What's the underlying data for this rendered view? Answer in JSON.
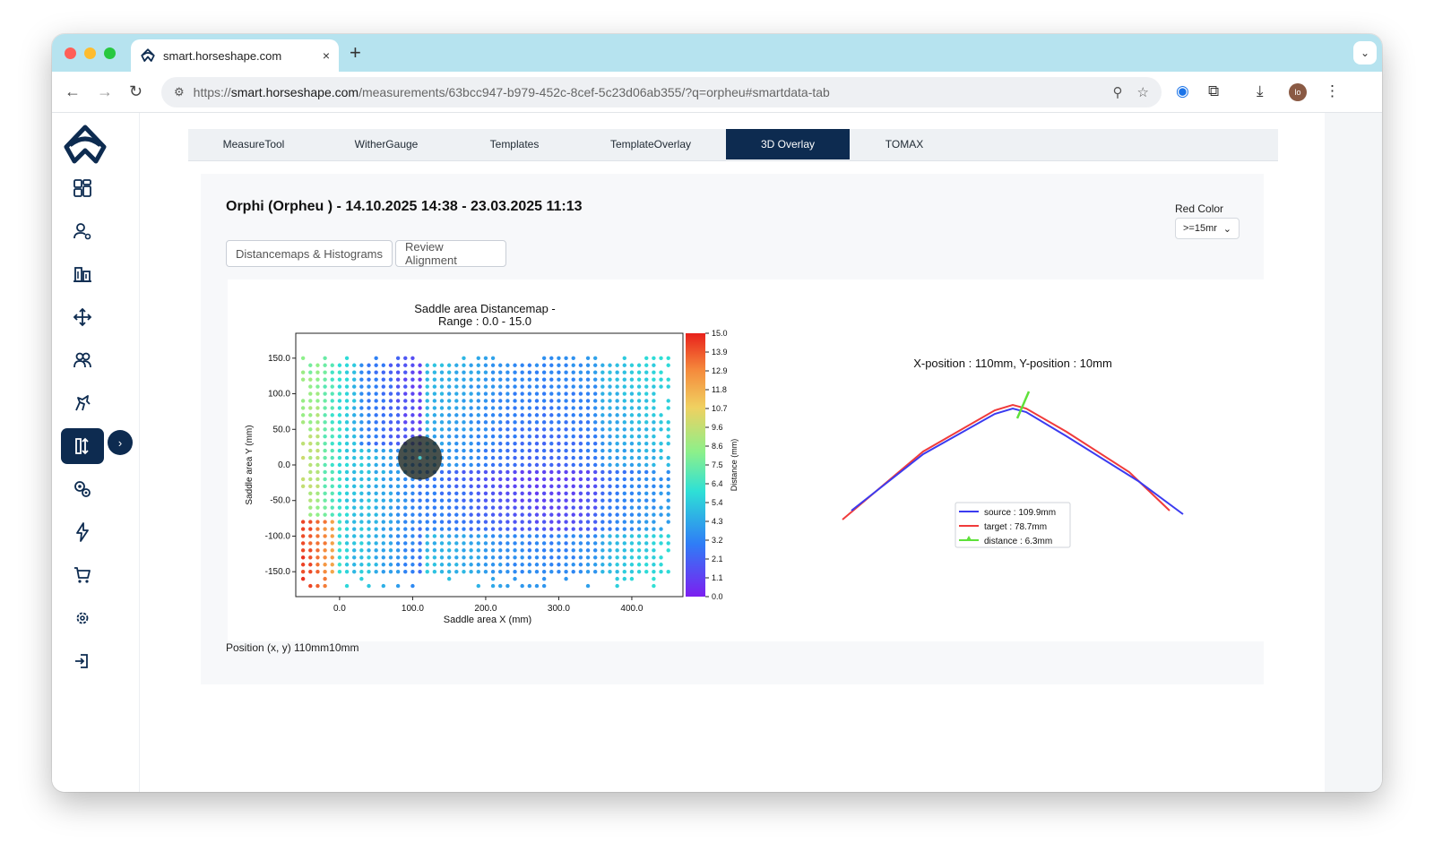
{
  "browser": {
    "tab_title": "smart.horseshape.com",
    "new_tab": "+",
    "close": "×",
    "url_prefix": "https://",
    "url_host": "smart.horseshape.com",
    "url_path": "/measurements/63bcc947-b979-452c-8cef-5c23d06ab355/?q=orpheu#smartdata-tab",
    "profile_initials": "lo"
  },
  "sidebar": {
    "items": [
      {
        "icon": "dashboard-icon"
      },
      {
        "icon": "user-icon"
      },
      {
        "icon": "building-icon"
      },
      {
        "icon": "move-arrows-icon"
      },
      {
        "icon": "team-icon"
      },
      {
        "icon": "horse-icon"
      },
      {
        "icon": "measure-compare-icon",
        "active": true
      },
      {
        "icon": "gears-icon"
      },
      {
        "icon": "lightning-icon"
      },
      {
        "icon": "cart-icon"
      },
      {
        "icon": "settings-icon"
      },
      {
        "icon": "logout-icon"
      }
    ],
    "expand": "›"
  },
  "tabs": [
    {
      "label": "MeasureTool",
      "active": false
    },
    {
      "label": "WitherGauge",
      "active": false
    },
    {
      "label": "Templates",
      "active": false
    },
    {
      "label": "TemplateOverlay",
      "active": false
    },
    {
      "label": "3D Overlay",
      "active": true
    },
    {
      "label": "TOMAX",
      "active": false
    }
  ],
  "card": {
    "title": "Orphi (Orpheu ) - 14.10.2025 14:38 - 23.03.2025 11:13",
    "buttons": [
      "Distancemaps & Histograms",
      "Review Alignment"
    ],
    "red_color_label": "Red Color",
    "red_color_value": ">=15mr",
    "position_text": "Position (x, y) 110mm10mm"
  },
  "chart_data": [
    {
      "type": "scatter",
      "title": "Saddle area Distancemap -",
      "subtitle": "Range : 0.0 - 15.0",
      "xlabel": "Saddle area X (mm)",
      "ylabel": "Saddle area Y (mm)",
      "xlim": [
        -60,
        470
      ],
      "ylim": [
        -185,
        185
      ],
      "xticks": [
        0,
        100,
        200,
        300,
        400
      ],
      "xtick_labels": [
        "0.0",
        "100.0",
        "200.0",
        "300.0",
        "400.0"
      ],
      "yticks": [
        150,
        100,
        50,
        0,
        -50,
        -100,
        -150
      ],
      "ytick_labels": [
        "150.0",
        "100.0",
        "50.0",
        "0.0",
        "-50.0",
        "-100.0",
        "-150.0"
      ],
      "colorbar": {
        "label": "Distance (mm)",
        "range": [
          0,
          15
        ],
        "ticks": [
          "15.0",
          "13.9",
          "12.9",
          "11.8",
          "10.7",
          "9.6",
          "8.6",
          "7.5",
          "6.4",
          "5.4",
          "4.3",
          "3.2",
          "2.1",
          "1.1",
          "0.0"
        ]
      },
      "grid_spacing_mm": [
        10,
        10
      ],
      "highlight": {
        "x": 110,
        "y": 10,
        "radius_mm": 30
      },
      "colors": {
        "high": "#e8211b",
        "low": "#7c1ff0"
      }
    },
    {
      "type": "line",
      "title": "X-position : 110mm, Y-position : 10mm",
      "series": [
        {
          "name": "source : 109.9mm",
          "color": "#3b3bf0",
          "points": [
            [
              -180,
              -58
            ],
            [
              -100,
              5
            ],
            [
              -20,
              50
            ],
            [
              0,
              56
            ],
            [
              15,
              52
            ],
            [
              60,
              25
            ],
            [
              140,
              -25
            ],
            [
              190,
              -62
            ]
          ]
        },
        {
          "name": "target : 78.7mm",
          "color": "#f03b3b",
          "points": [
            [
              -190,
              -68
            ],
            [
              -100,
              8
            ],
            [
              -20,
              54
            ],
            [
              0,
              60
            ],
            [
              15,
              56
            ],
            [
              60,
              30
            ],
            [
              130,
              -15
            ],
            [
              175,
              -58
            ]
          ]
        },
        {
          "name": "distance : 6.3mm",
          "color": "#5ee13a",
          "points": [
            [
              5,
              45
            ],
            [
              18,
              75
            ]
          ]
        }
      ]
    }
  ]
}
